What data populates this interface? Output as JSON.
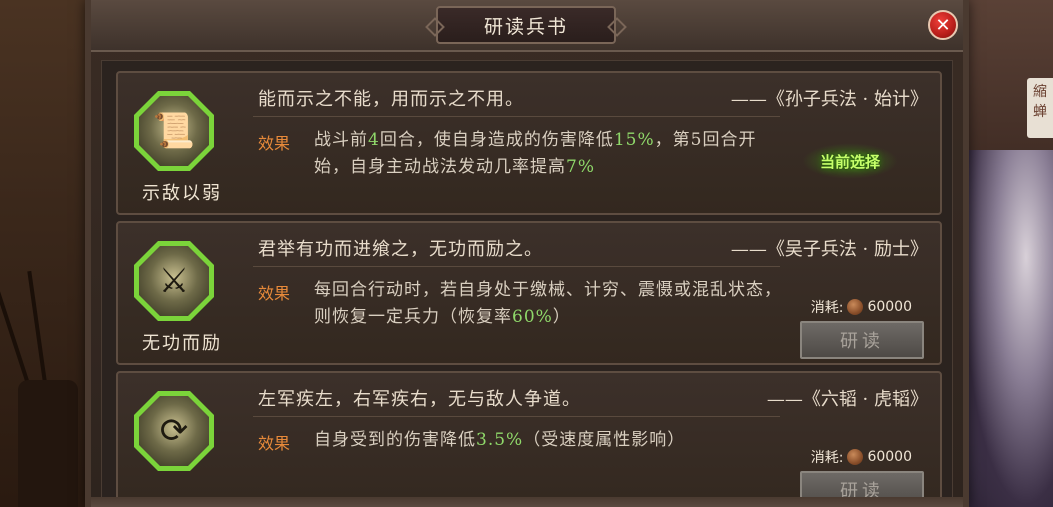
{
  "title": "研读兵书",
  "close_label": "✕",
  "background_tag": "縮蝉",
  "skills": [
    {
      "name": "示敌以弱",
      "quote": "能而示之不能，用而示之不用。",
      "source": "——《孙子兵法 · 始计》",
      "effect_label": "效果",
      "effect_parts": [
        "战斗前",
        "4",
        "回合，使自身造成的伤害降低",
        "15%",
        "，第",
        "5",
        "回合开始，自身主动战法发动几率提高",
        "7%"
      ],
      "status": "当前选择",
      "icon": "scroll-figure-icon"
    },
    {
      "name": "无功而励",
      "quote": "君举有功而进飨之，无功而励之。",
      "source": "——《吴子兵法 · 励士》",
      "effect_label": "效果",
      "effect_parts": [
        "每回合行动时，若自身处于缴械、计穷、震慑或混乱状态，则恢复一定兵力（恢复率",
        "60%",
        "）"
      ],
      "cost_label": "消耗:",
      "cost_value": "60000",
      "button_label": "研读",
      "icon": "warrior-sword-icon"
    },
    {
      "name": "",
      "quote": "左军疾左，右军疾右，无与敌人争道。",
      "source": "——《六韬 · 虎韬》",
      "effect_label": "效果",
      "effect_parts": [
        "自身受到的伤害降低",
        "3.5%",
        "（受速度属性影响）"
      ],
      "cost_label": "消耗:",
      "cost_value": "60000",
      "button_label": "研读",
      "icon": "circular-arrows-icon"
    }
  ]
}
